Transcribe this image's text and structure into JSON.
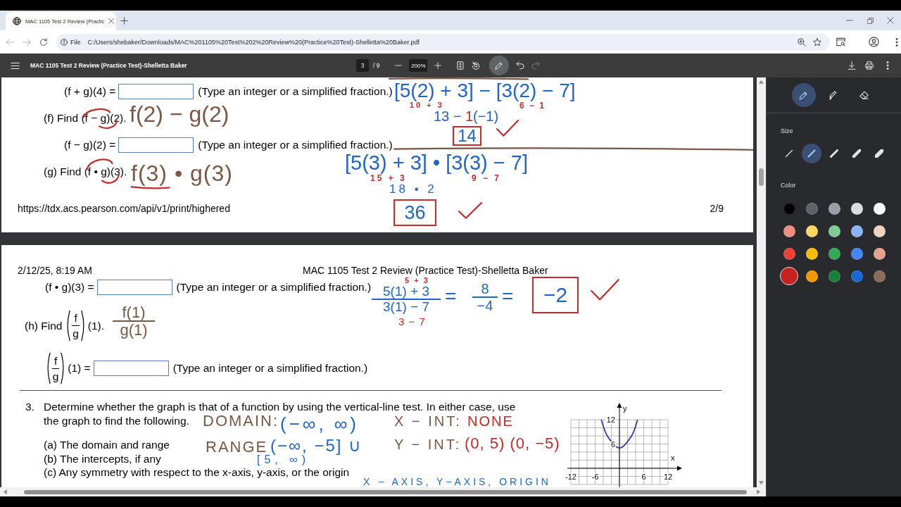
{
  "tab": {
    "title": "MAC 1105 Test 2 Review (Practic",
    "selected": true
  },
  "navigation": {
    "back": {
      "disabled": true
    },
    "forward": {
      "disabled": true
    }
  },
  "address_bar": {
    "chip": "File",
    "url": "C:/Users/shebaker/Downloads/MAC%201105%20Test%202%20Review%20(Practice%20Test)-Shelletta%20Baker.pdf"
  },
  "pdf_toolbar": {
    "title": "MAC 1105 Test 2 Review (Practice Test)-Shelletta Baker",
    "page": "3",
    "page_total": "/ 9",
    "zoom": "200%",
    "annotate": {
      "selected": true
    },
    "redo": {
      "disabled": true
    }
  },
  "pages": [
    {
      "lines": [
        {
          "kind": "answer",
          "label": "(f + g)(4) =",
          "hint": "(Type an integer or a simplified fraction.)"
        },
        {
          "kind": "find",
          "text": "(f) Find (f − g)(2)."
        },
        {
          "kind": "answer",
          "label": "(f − g)(2) =",
          "hint": "(Type an integer or a simplified fraction.)"
        },
        {
          "kind": "find",
          "text": "(g) Find (f • g)(3)."
        }
      ],
      "footer": {
        "url": "https://tdx.acs.pearson.com/api/v1/print/highered",
        "page": "2/9"
      },
      "ink": [
        {
          "kind": "text",
          "text": "f(2) − g(2)",
          "color": "#7b5643"
        },
        {
          "kind": "circle",
          "color": "#c42b2b"
        },
        {
          "kind": "text",
          "text": "f(3) • g(3)",
          "color": "#7b5643"
        },
        {
          "kind": "circle",
          "color": "#c42b2b"
        },
        {
          "kind": "underline",
          "color": "#c42b2b"
        },
        {
          "kind": "line",
          "color": "#7b5643"
        },
        {
          "kind": "line",
          "color": "#7b5643"
        },
        {
          "kind": "text",
          "text": "[5(2) + 3] − [3(2) − 7]",
          "color": "#1f64c8"
        },
        {
          "kind": "text",
          "text": "10 + 3",
          "color": "#c42b2b"
        },
        {
          "kind": "text",
          "text": "6 − 1",
          "color": "#c42b2b"
        },
        {
          "kind": "text",
          "text": "13 −",
          "color": "#1f64c8"
        },
        {
          "kind": "text",
          "text": "1",
          "color": "#c42b2b"
        },
        {
          "kind": "text",
          "text": "(−1)",
          "color": "#1f64c8"
        },
        {
          "kind": "boxed",
          "text": "14",
          "color": "#1f64c8",
          "box": {
            "color": "#c42b2b"
          }
        },
        {
          "kind": "check",
          "color": "#c42b2b"
        },
        {
          "kind": "text",
          "text": "[5(3) + 3] • [3(3) − 7]",
          "color": "#1f64c8"
        },
        {
          "kind": "text",
          "text": "15 + 3",
          "color": "#c42b2b"
        },
        {
          "kind": "text",
          "text": "9 − 7",
          "color": "#c42b2b"
        },
        {
          "kind": "text",
          "text": "18 • 2",
          "color": "#1f64c8"
        },
        {
          "kind": "boxed",
          "text": "36",
          "color": "#1f64c8",
          "box": {
            "color": "#c42b2b"
          }
        },
        {
          "kind": "check",
          "color": "#c42b2b"
        }
      ]
    },
    {
      "header": {
        "date": "2/12/25, 8:19 AM",
        "title": "MAC 1105 Test 2 Review (Practice Test)-Shelletta Baker"
      },
      "lines": [
        {
          "kind": "answer",
          "label": "(f • g)(3) =",
          "hint": "(Type an integer or a simplified fraction.)"
        },
        {
          "kind": "find_fraction",
          "prefix": "(h) Find",
          "numerator": "f",
          "denominator": "g",
          "suffix": "(1)."
        },
        {
          "kind": "answer_fraction",
          "numerator": "f",
          "denominator": "g",
          "suffix": "(1) =",
          "hint": "(Type an integer or a simplified fraction.)"
        },
        {
          "kind": "rule"
        }
      ],
      "question": {
        "number": "3.",
        "text_lines": [
          "Determine whether the graph is that of a function by using the vertical-line test. In either case, use",
          "the graph to find the following."
        ],
        "parts": [
          "(a) The domain and range",
          "(b) The intercepts, if any",
          "(c) Any symmetry with respect to the x-axis, y-axis, or the origin"
        ],
        "chart_data": {
          "type": "line",
          "grid": true,
          "xlabel": "x",
          "ylabel": "y",
          "x": [
            -4.5,
            -3,
            0,
            3,
            4.5
          ],
          "series": [
            {
              "color": "#2a2aa8",
              "values": [
                12,
                8,
                5,
                8,
                12
              ]
            }
          ],
          "xlim": [
            -12,
            12
          ],
          "ylim": [
            -4,
            12
          ],
          "xticks": [
            -12,
            -6,
            6,
            12
          ],
          "yticks": [
            6,
            12
          ]
        }
      },
      "ink": [
        {
          "kind": "text",
          "text": "5 + 3",
          "color": "#c42b2b"
        },
        {
          "kind": "fraction",
          "numerator": "5(1) + 3",
          "denominator": "3(1) − 7",
          "color": "#1f64c8"
        },
        {
          "kind": "text",
          "text": "3 − 7",
          "color": "#c42b2b"
        },
        {
          "kind": "text",
          "text": "=",
          "color": "#1f64c8"
        },
        {
          "kind": "fraction",
          "numerator": "8",
          "denominator": "−4",
          "color": "#1f64c8"
        },
        {
          "kind": "text",
          "text": "=",
          "color": "#1f64c8"
        },
        {
          "kind": "boxed",
          "text": "−2",
          "color": "#1f64c8",
          "box": {
            "color": "#c42b2b"
          }
        },
        {
          "kind": "check",
          "color": "#c42b2b"
        },
        {
          "kind": "fraction",
          "numerator": "f(1)",
          "denominator": "g(1)",
          "color": "#7b5643"
        },
        {
          "kind": "text",
          "text": "DOMAIN:",
          "color": "#7b5643"
        },
        {
          "kind": "text",
          "text": "(−∞, ∞)",
          "color": "#1f64c8"
        },
        {
          "kind": "text",
          "text": "X − INT:",
          "color": "#7b5643"
        },
        {
          "kind": "text",
          "text": "NONE",
          "color": "#c42b2b"
        },
        {
          "kind": "text",
          "text": "RANGE",
          "color": "#7b5643"
        },
        {
          "kind": "text",
          "text": "(−∞, −5] ∪",
          "color": "#1f64c8"
        },
        {
          "kind": "text",
          "text": "[5, ∞)",
          "color": "#1f64c8"
        },
        {
          "kind": "text",
          "text": "Y − INT:",
          "color": "#7b5643"
        },
        {
          "kind": "text",
          "text": "(0, 5) (0, −5)",
          "color": "#c42b2b"
        },
        {
          "kind": "text",
          "text": "X − AXIS, Y−AXIS, ORIGIN",
          "color": "#1f64c8"
        }
      ]
    }
  ],
  "annotation_panel": {
    "tools": [
      {
        "kind": "pen",
        "selected": true
      },
      {
        "kind": "highlighter",
        "selected": false
      },
      {
        "kind": "eraser",
        "selected": false
      }
    ],
    "size_label": "Size",
    "sizes": [
      {
        "selected": false
      },
      {
        "selected": true
      },
      {
        "selected": false
      },
      {
        "selected": false
      },
      {
        "selected": false
      }
    ],
    "color_label": "Color",
    "colors": [
      {
        "color": "#000000",
        "selected": false
      },
      {
        "color": "#5f6368",
        "selected": false
      },
      {
        "color": "#9aa0a6",
        "selected": false
      },
      {
        "color": "#dadce0",
        "selected": false
      },
      {
        "color": "#ffffff",
        "selected": false
      },
      {
        "color": "#f28b82",
        "selected": false
      },
      {
        "color": "#fdd663",
        "selected": false
      },
      {
        "color": "#81c995",
        "selected": false
      },
      {
        "color": "#8ab4f8",
        "selected": false
      },
      {
        "color": "#eed3bf",
        "selected": false
      },
      {
        "color": "#ea4335",
        "selected": false
      },
      {
        "color": "#fbbc04",
        "selected": false
      },
      {
        "color": "#34a853",
        "selected": false
      },
      {
        "color": "#4285f4",
        "selected": false
      },
      {
        "color": "#e2a38f",
        "selected": false
      },
      {
        "color": "#c5221f",
        "selected": true
      },
      {
        "color": "#f29900",
        "selected": false
      },
      {
        "color": "#188038",
        "selected": false
      },
      {
        "color": "#1967d2",
        "selected": false
      },
      {
        "color": "#8b6b5c",
        "selected": false
      }
    ]
  }
}
